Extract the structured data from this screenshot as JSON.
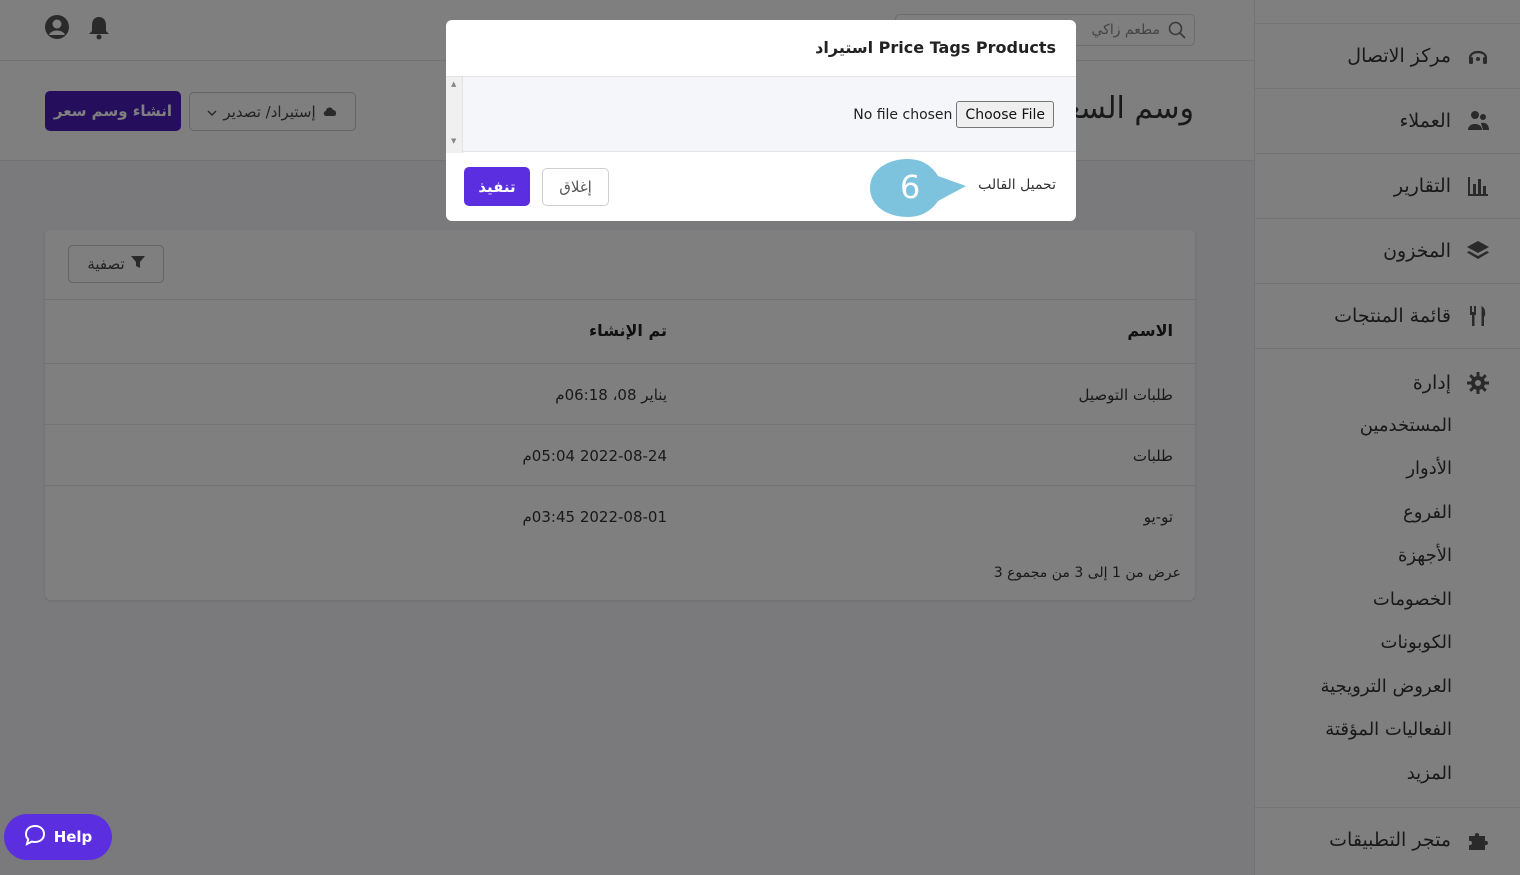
{
  "topbar": {
    "search_placeholder": "مطعم زاكي"
  },
  "header": {
    "title": "وسم السعر",
    "import_export_label": "إستيراد/ تصدير",
    "create_label": "انشاء وسم سعر"
  },
  "sidebar": {
    "items": [
      {
        "label": "مركز الاتصال",
        "icon": "headset-icon"
      },
      {
        "label": "العملاء",
        "icon": "users-icon"
      },
      {
        "label": "التقارير",
        "icon": "bar-chart-icon"
      },
      {
        "label": "المخزون",
        "icon": "layers-icon"
      },
      {
        "label": "قائمة المنتجات",
        "icon": "utensils-icon"
      },
      {
        "label": "إدارة",
        "icon": "gear-icon"
      }
    ],
    "sub_items": [
      "المستخدمين",
      "الأدوار",
      "الفروع",
      "الأجهزة",
      "الخصومات",
      "الكوبونات",
      "العروض الترويجية",
      "الفعاليات المؤقتة",
      "المزيد"
    ],
    "app_store": {
      "label": "متجر التطبيقات",
      "icon": "puzzle-icon"
    }
  },
  "table": {
    "filter_label": "تصفية",
    "columns": {
      "name": "الاسم",
      "created": "تم الإنشاء"
    },
    "rows": [
      {
        "name": "طلبات التوصيل",
        "created": "يناير 08، 06:18م"
      },
      {
        "name": "طلبات",
        "created": "2022-08-24 05:04م"
      },
      {
        "name": "تو-يو",
        "created": "2022-08-01 03:45م"
      }
    ],
    "pagination_text": "عرض من 1 إلى 3 من مجموع 3"
  },
  "modal": {
    "title": "استيراد Price Tags Products",
    "file_button": "Choose File",
    "file_status": "No file chosen",
    "download_template": "تحميل القالب",
    "close_label": "إغلاق",
    "submit_label": "تنفيذ"
  },
  "callout": {
    "step": "6"
  },
  "help": {
    "label": "Help"
  },
  "colors": {
    "primary": "#4a1fb8",
    "accent": "#5b2ee0",
    "callout": "#7ec3de"
  }
}
